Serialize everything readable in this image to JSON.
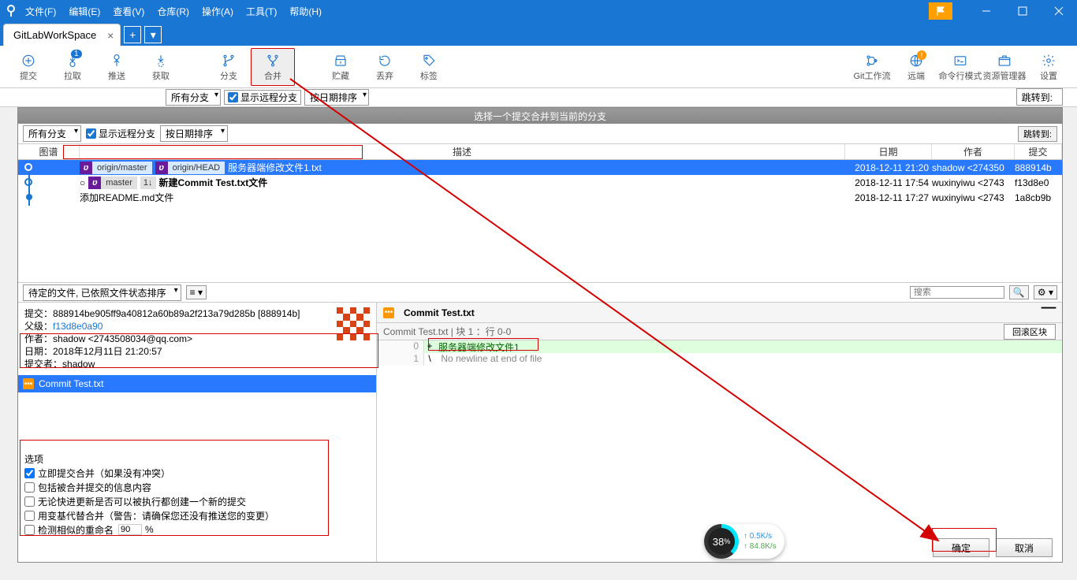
{
  "menubar": {
    "file": "文件(F)",
    "edit": "编辑(E)",
    "view": "查看(V)",
    "repo": "仓库(R)",
    "action": "操作(A)",
    "tools": "工具(T)",
    "help": "帮助(H)"
  },
  "tab": {
    "name": "GitLabWorkSpace"
  },
  "toolbar": {
    "commit": "提交",
    "pull": "拉取",
    "pull_badge": "1",
    "push": "推送",
    "fetch": "获取",
    "branch": "分支",
    "merge": "合并",
    "stash": "贮藏",
    "discard": "丢弃",
    "tag": "标签",
    "gitflow": "Git工作流",
    "remote": "远端",
    "cmdmode": "命令行模式",
    "explorer": "资源管理器",
    "settings": "设置"
  },
  "bg_filters": {
    "all_branches": "所有分支",
    "show_remote": "显示远程分支",
    "sort_by_date": "按日期排序",
    "jump": "跳转到:"
  },
  "dialog": {
    "title": "选择一个提交合并到当前的分支",
    "all_branches": "所有分支",
    "show_remote": "显示远程分支",
    "sort_by_date": "按日期排序",
    "jump": "跳转到:"
  },
  "table": {
    "headers": {
      "graph": "图谱",
      "desc": "描述",
      "date": "日期",
      "author": "作者",
      "commit": "提交"
    },
    "rows": [
      {
        "selected": true,
        "refs": [
          {
            "type": "remote",
            "name": "origin/master"
          },
          {
            "type": "remote",
            "name": "origin/HEAD"
          }
        ],
        "desc": "服务器端修改文件1.txt",
        "date": "2018-12-11 21:20",
        "author": "shadow <274350",
        "commit": "888914b"
      },
      {
        "refs": [
          {
            "type": "local",
            "name": "master",
            "behind": "1↓"
          }
        ],
        "desc_bold": "新建Commit Test.txt文件",
        "date": "2018-12-11 17:54",
        "author": "wuxinyiwu <2743",
        "commit": "f13d8e0"
      },
      {
        "desc": "添加README.md文件",
        "date": "2018-12-11 17:27",
        "author": "wuxinyiwu <2743",
        "commit": "1a8cb9b"
      }
    ]
  },
  "midbar": {
    "sort": "待定的文件, 已依照文件状态排序",
    "search_placeholder": "搜索"
  },
  "meta": {
    "commit_label": "提交：",
    "commit_hash": "888914be905ff9a40812a60b89a2f213a79d285b [888914b]",
    "parent_label": "父级：",
    "parent_hash": "f13d8e0a90",
    "author_label": "作者：",
    "author": "shadow <2743508034@qq.com>",
    "date_label": "日期：",
    "date": "2018年12月11日 21:20:57",
    "committer_label": "提交者：",
    "committer": "shadow"
  },
  "file_list": {
    "file1": "Commit Test.txt"
  },
  "diff": {
    "filename": "Commit Test.txt",
    "hunk_info": "Commit Test.txt  | 块 1 ：行 0-0",
    "rollback": "回滚区块",
    "lines": [
      {
        "ln1": "",
        "ln2": "0",
        "type": "add",
        "marker": "+",
        "text": "服务器端修改文件1"
      },
      {
        "ln1": "",
        "ln2": "1",
        "type": "ctx",
        "marker": "\\",
        "text": " No newline at end of file"
      }
    ]
  },
  "options": {
    "title": "选项",
    "opt1": "立即提交合并（如果没有冲突）",
    "opt2": "包括被合并提交的信息内容",
    "opt3": "无论快进更新是否可以被执行都创建一个新的提交",
    "opt4": "用变基代替合并（警告：请确保您还没有推送您的变更）",
    "opt5": "检测相似的重命名",
    "rename_pct": "90",
    "pct_suffix": "%"
  },
  "buttons": {
    "ok": "确定",
    "cancel": "取消"
  },
  "net": {
    "pct": "38",
    "pct_suffix": "%",
    "up": "↑ 0.5K/s",
    "down": "↑ 84.8K/s"
  }
}
